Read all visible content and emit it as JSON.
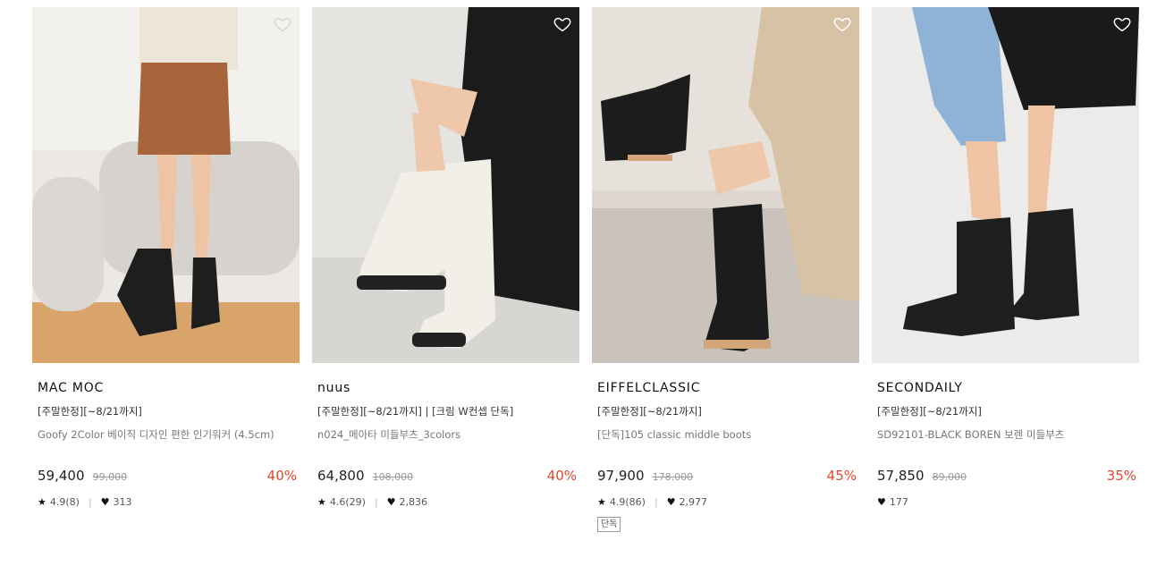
{
  "products": [
    {
      "brand": "MAC MOC",
      "promo": "[주말한정][~8/21까지]",
      "name": "Goofy 2Color 베이직 디자인 편한 인기워커 (4.5cm)",
      "price": "59,400",
      "original_price": "99,000",
      "discount": "40%",
      "rating": "4.9(8)",
      "likes": "313",
      "tag": "",
      "image": "lace-up-combat-boots",
      "wish_icon": "heart-outline-icon"
    },
    {
      "brand": "nuus",
      "promo": "[주말한정][~8/21까지] | [크림 W컨셉 단독]",
      "name": "n024_메아타 미들부츠_3colors",
      "price": "64,800",
      "original_price": "108,000",
      "discount": "40%",
      "rating": "4.6(29)",
      "likes": "2,836",
      "tag": "",
      "image": "cream-middle-boots",
      "wish_icon": "heart-outline-icon"
    },
    {
      "brand": "EIFFELCLASSIC",
      "promo": "[주말한정][~8/21까지]",
      "name": "[단독]105 classic middle boots",
      "price": "97,900",
      "original_price": "178,000",
      "discount": "45%",
      "rating": "4.9(86)",
      "likes": "2,977",
      "tag": "단독",
      "image": "black-slouch-boots",
      "wish_icon": "heart-outline-icon"
    },
    {
      "brand": "SECONDAILY",
      "promo": "[주말한정][~8/21까지]",
      "name": "SD92101-BLACK BOREN 보렌 미들부츠",
      "price": "57,850",
      "original_price": "89,000",
      "discount": "35%",
      "rating": "",
      "likes": "177",
      "tag": "",
      "image": "black-western-boots",
      "wish_icon": "heart-outline-icon"
    }
  ],
  "colors": {
    "discount": "#e0452e",
    "price": "#222222",
    "original_price": "#999999"
  },
  "icons": {
    "star": "star-icon",
    "heart": "heart-icon"
  }
}
